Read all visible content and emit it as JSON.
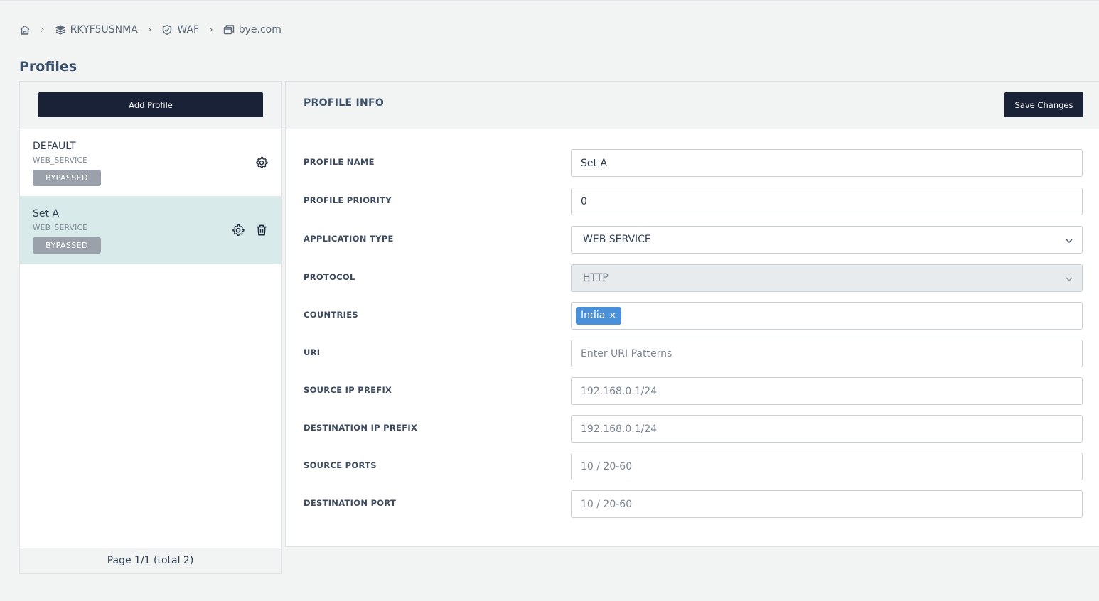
{
  "breadcrumb": {
    "items": [
      {
        "label": "",
        "icon": "home-icon"
      },
      {
        "label": "RKYF5USNMA",
        "icon": "layers-icon"
      },
      {
        "label": "WAF",
        "icon": "shield-icon"
      },
      {
        "label": "bye.com",
        "icon": "window-icon"
      }
    ],
    "separator": "›"
  },
  "page": {
    "title": "Profiles"
  },
  "left": {
    "add_label": "Add Profile",
    "profiles": [
      {
        "name": "DEFAULT",
        "type": "WEB_SERVICE",
        "badge": "BYPASSED"
      },
      {
        "name": "Set A",
        "type": "WEB_SERVICE",
        "badge": "BYPASSED"
      }
    ],
    "footer": "Page 1/1 (total 2)"
  },
  "right": {
    "title": "PROFILE INFO",
    "save_label": "Save Changes",
    "fields": {
      "profile_name": {
        "label": "PROFILE NAME",
        "value": "Set A"
      },
      "profile_priority": {
        "label": "PROFILE PRIORITY",
        "value": "0"
      },
      "application_type": {
        "label": "APPLICATION TYPE",
        "value": "WEB SERVICE"
      },
      "protocol": {
        "label": "PROTOCOL",
        "value": "HTTP"
      },
      "countries": {
        "label": "COUNTRIES",
        "tags": [
          "India"
        ],
        "remove": "×"
      },
      "uri": {
        "label": "URI",
        "placeholder": "Enter URI Patterns"
      },
      "source_ip": {
        "label": "SOURCE IP PREFIX",
        "placeholder": "192.168.0.1/24"
      },
      "destination_ip": {
        "label": "DESTINATION IP PREFIX",
        "placeholder": "192.168.0.1/24"
      },
      "source_ports": {
        "label": "SOURCE PORTS",
        "placeholder": "10 / 20-60"
      },
      "destination_port": {
        "label": "DESTINATION PORT",
        "placeholder": "10 / 20-60"
      }
    }
  },
  "colors": {
    "background": "#f2f4f3",
    "dark_button": "#1a2238",
    "selected_row": "#d8ebea",
    "badge": "#9aa1aa",
    "tag": "#4a90d9"
  }
}
